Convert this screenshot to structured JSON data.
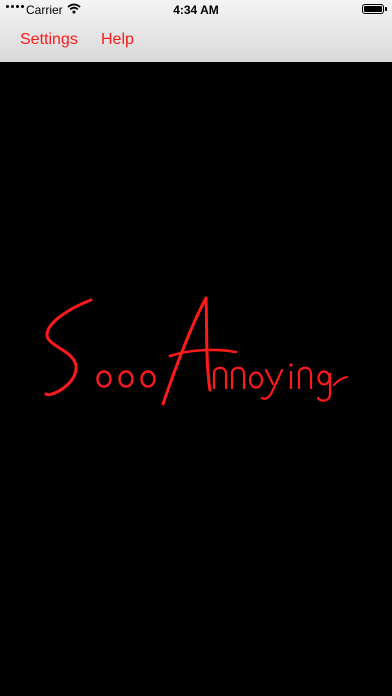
{
  "status_bar": {
    "carrier": "Carrier",
    "time": "4:34 AM",
    "icons": [
      "signal-dots-icon",
      "wifi-icon",
      "battery-icon"
    ]
  },
  "nav": {
    "settings_label": "Settings",
    "help_label": "Help"
  },
  "logo": {
    "text": "SoooAnnoying"
  },
  "colors": {
    "accent": "#ff1a1a",
    "background": "#000000",
    "nav_background": "#e6e6e6"
  }
}
